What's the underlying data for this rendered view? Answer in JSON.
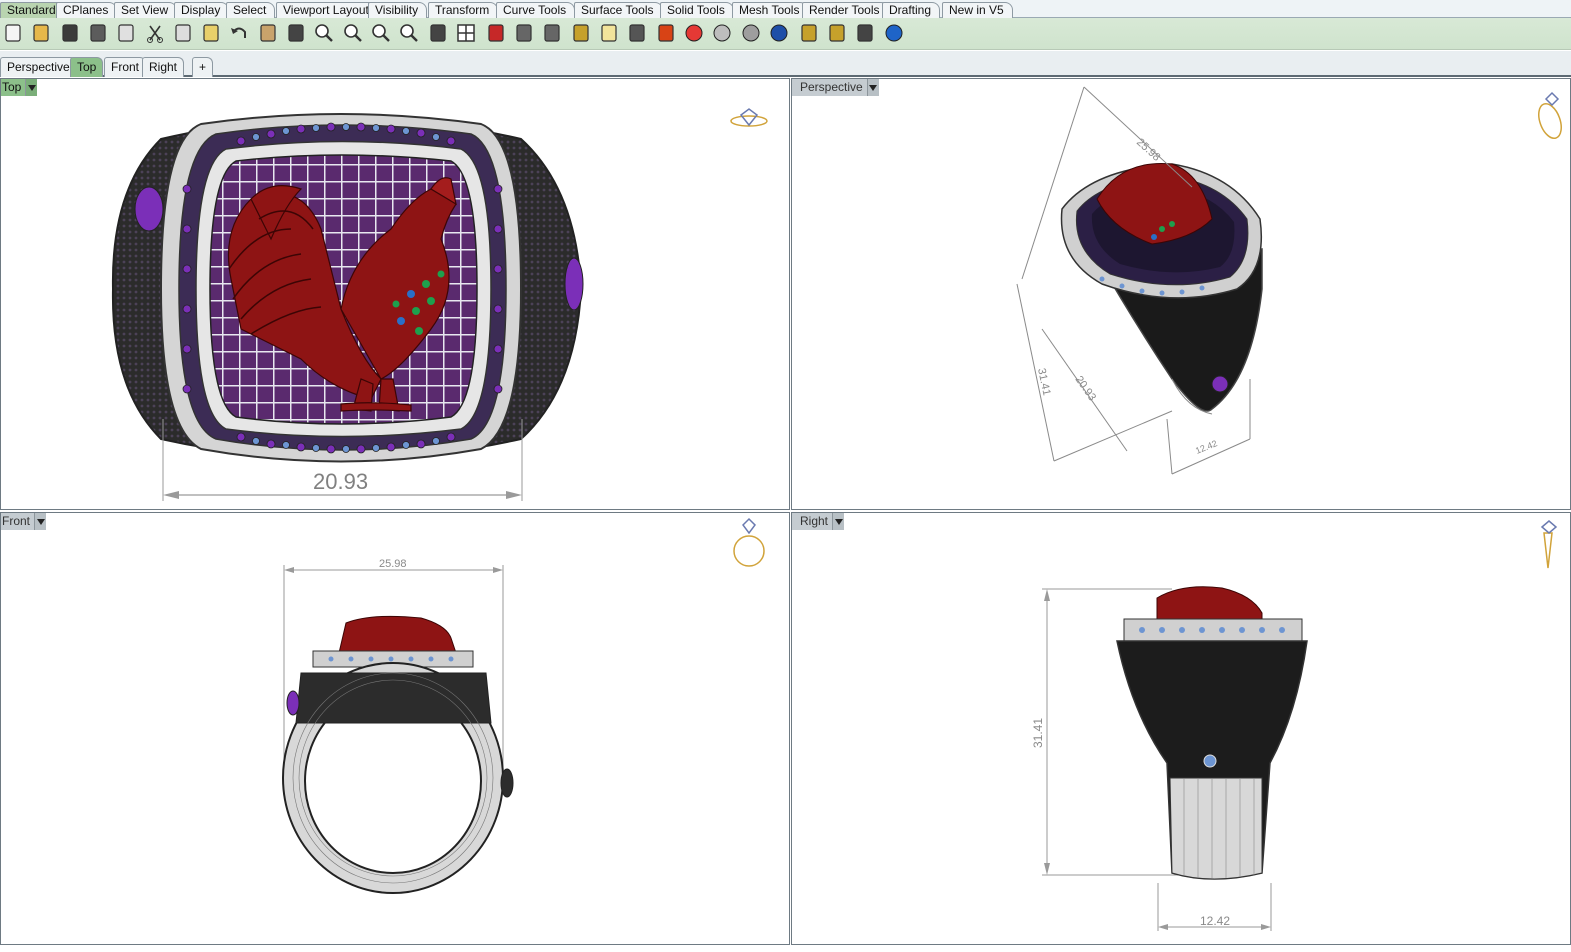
{
  "toolbar_tabs": [
    {
      "label": "Standard",
      "active": true
    },
    {
      "label": "CPlanes"
    },
    {
      "label": "Set View"
    },
    {
      "label": "Display"
    },
    {
      "label": "Select"
    },
    {
      "label": "Viewport Layout"
    },
    {
      "label": "Visibility"
    },
    {
      "label": "Transform"
    },
    {
      "label": "Curve Tools"
    },
    {
      "label": "Surface Tools"
    },
    {
      "label": "Solid Tools"
    },
    {
      "label": "Mesh Tools"
    },
    {
      "label": "Render Tools"
    },
    {
      "label": "Drafting"
    },
    {
      "label": "New in V5"
    }
  ],
  "toolbar_icons": [
    "new-file-icon",
    "open-folder-icon",
    "save-icon",
    "print-icon",
    "import-icon",
    "cut-icon",
    "copy-icon",
    "paste-icon",
    "undo-icon",
    "pan-hand-icon",
    "move-view-icon",
    "zoom-icon",
    "zoom-window-icon",
    "zoom-extents-icon",
    "zoom-selected-icon",
    "rotate-view-icon",
    "four-viewports-icon",
    "car-icon",
    "named-view-icon",
    "sun-icon",
    "object-snap-icon",
    "light-bulb-icon",
    "lock-icon",
    "layers-icon",
    "color-wheel-icon",
    "wireframe-sphere-icon",
    "shaded-sphere-icon",
    "rendered-sphere-icon",
    "paint-bucket-icon",
    "gear-icon",
    "dimension-icon",
    "help-icon"
  ],
  "viewport_tabs": [
    {
      "label": "Perspective"
    },
    {
      "label": "Top",
      "active": true
    },
    {
      "label": "Front"
    },
    {
      "label": "Right"
    },
    {
      "label": "+"
    }
  ],
  "viewports": {
    "top": {
      "label": "Top",
      "dimension": "20.93"
    },
    "perspective": {
      "label": "Perspective",
      "dim_a": "25.98",
      "dim_b": "31.41",
      "dim_c": "20.93",
      "dim_d": "12.42"
    },
    "front": {
      "label": "Front",
      "dimension": "25.98"
    },
    "right": {
      "label": "Right",
      "dim_height": "31.41",
      "dim_width": "12.42"
    }
  },
  "colors": {
    "ring_metal": "#3a3a3a",
    "rooster_red": "#8e1414",
    "gem_purple": "#7b2fb8",
    "gem_blue": "#5b86c9",
    "active_tab": "#8cc08a"
  }
}
